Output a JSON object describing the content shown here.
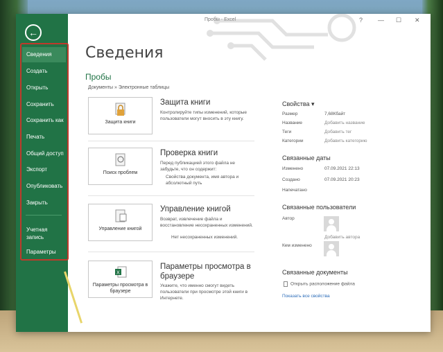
{
  "window": {
    "title": "Пробы - Excel",
    "controls": {
      "help": "?",
      "minimize": "—",
      "restore": "☐",
      "close": "✕"
    }
  },
  "sidebar": {
    "back_icon": "back-arrow-icon",
    "items": [
      {
        "label": "Сведения",
        "active": true
      },
      {
        "label": "Создать"
      },
      {
        "label": "Открыть"
      },
      {
        "label": "Сохранить"
      },
      {
        "label": "Сохранить как"
      },
      {
        "label": "Печать"
      },
      {
        "label": "Общий доступ"
      },
      {
        "label": "Экспорт"
      },
      {
        "label": "Опубликовать"
      },
      {
        "label": "Закрыть"
      },
      {
        "label": "Учетная запись"
      },
      {
        "label": "Параметры"
      }
    ]
  },
  "main": {
    "title": "Сведения",
    "doc_name": "Пробы",
    "doc_path": "Документы » Электронные таблицы",
    "sections": [
      {
        "button_label": "Защита книги",
        "title": "Защита книги",
        "desc": "Контролируйте типы изменений, которые пользователи могут вносить в эту книгу.",
        "bullets": []
      },
      {
        "button_label": "Поиск проблем",
        "title": "Проверка книги",
        "desc": "Перед публикацией этого файла не забудьте, что он содержит:",
        "bullets": [
          "Свойства документа, имя автора и абсолютный путь"
        ]
      },
      {
        "button_label": "Управление книгой",
        "title": "Управление книгой",
        "desc": "Возврат, извлечение файла и восстановление несохраненных изменений.",
        "bullets": [
          "Нет несохраненных изменений."
        ]
      },
      {
        "button_label": "Параметры просмотра в браузере",
        "title": "Параметры просмотра в браузере",
        "desc": "Укажите, что именно смогут видеть пользователи при просмотре этой книги в Интернете.",
        "bullets": []
      }
    ]
  },
  "properties": {
    "title": "Свойства",
    "rows": [
      {
        "label": "Размер",
        "value": "7,68Кбайт"
      },
      {
        "label": "Название",
        "value": "Добавить название"
      },
      {
        "label": "Теги",
        "value": "Добавить тег"
      },
      {
        "label": "Категории",
        "value": "Добавить категорию"
      }
    ],
    "dates_title": "Связанные даты",
    "dates": [
      {
        "label": "Изменено",
        "value": "07.09.2021 22:13"
      },
      {
        "label": "Создано",
        "value": "07.09.2021 20:23"
      },
      {
        "label": "Напечатано",
        "value": ""
      }
    ],
    "people_title": "Связанные пользователи",
    "author_label": "Автор",
    "add_author": "Добавить автора",
    "modified_by_label": "Кем изменено",
    "docs_title": "Связанные документы",
    "open_location": "Открыть расположение файла",
    "show_all": "Показать все свойства"
  },
  "colors": {
    "accent": "#217346",
    "highlight_border": "#c0392b",
    "annotation_arrow": "#e8d56a"
  }
}
